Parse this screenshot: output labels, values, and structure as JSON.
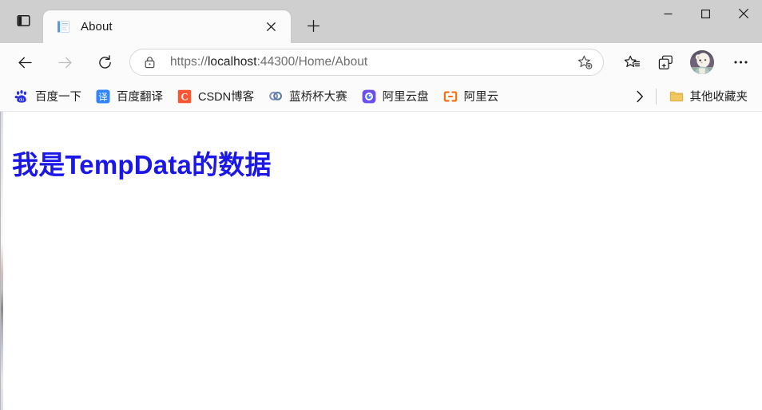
{
  "window": {
    "controls": {
      "minimize": "─",
      "maximize": "□",
      "close": "✕"
    }
  },
  "tabstrip": {
    "tab_actions_label": "tab-actions",
    "tabs": [
      {
        "title": "About",
        "favicon": "document-icon",
        "close_label": "✕"
      }
    ],
    "new_tab_label": "+"
  },
  "toolbar": {
    "back_label": "←",
    "forward_label": "→",
    "reload_label": "↻",
    "url": {
      "prefix": "https://",
      "host": "localhost",
      "suffix": ":44300/Home/About",
      "full": "https://localhost:44300/Home/About",
      "placeholder": "Search or enter web address"
    },
    "lock_icon": "lock-icon",
    "add_favorite_icon": "star-plus-icon",
    "favorites_icon": "favorites-star-icon",
    "collections_icon": "collections-icon",
    "profile_icon": "avatar",
    "settings_label": "•••"
  },
  "bookmarks": {
    "items": [
      {
        "label": "百度一下",
        "icon": "baidu-paw-icon",
        "color": "#2932e1"
      },
      {
        "label": "百度翻译",
        "icon": "baidu-fanyi-icon",
        "color": "#3385ff",
        "glyph": "译"
      },
      {
        "label": "CSDN博客",
        "icon": "csdn-icon",
        "color": "#fc5531",
        "glyph": "C"
      },
      {
        "label": "蓝桥杯大赛",
        "icon": "lanqiaobei-icon",
        "color": "#7b93b8"
      },
      {
        "label": "阿里云盘",
        "icon": "aliyunpan-icon",
        "color": "#6b4ef0"
      },
      {
        "label": "阿里云",
        "icon": "aliyun-icon",
        "color": "#ff6a00"
      }
    ],
    "overflow_label": "›",
    "other_folder": {
      "label": "其他收藏夹",
      "icon": "folder-icon",
      "color": "#f2c861"
    }
  },
  "page": {
    "heading": "我是TempData的数据",
    "heading_color": "#1a17e8",
    "background": "#ffffff"
  }
}
